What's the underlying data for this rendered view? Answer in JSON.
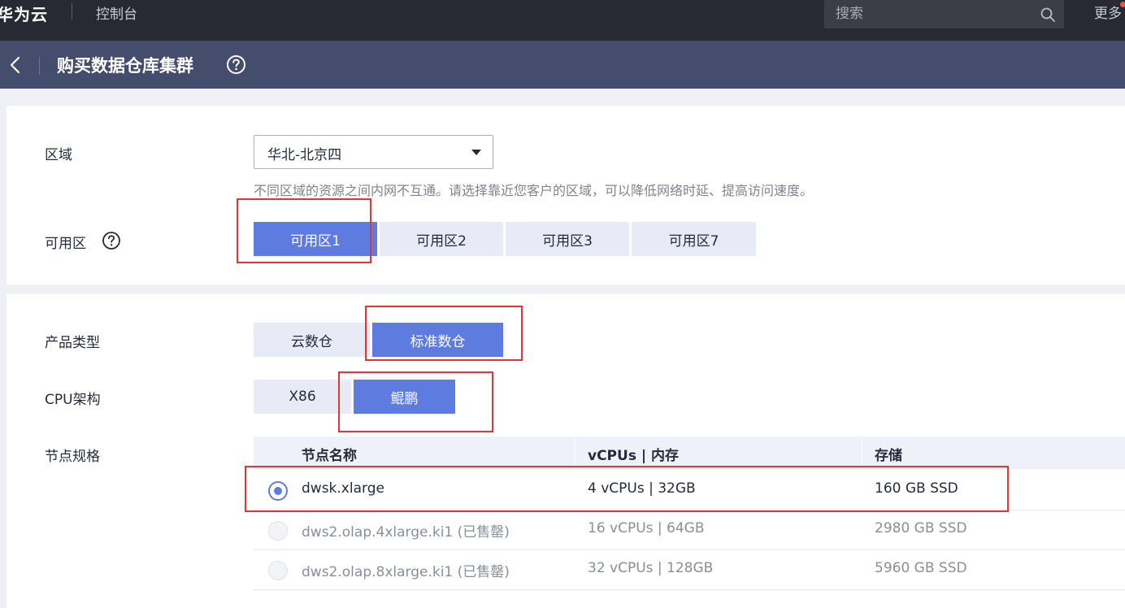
{
  "topbar": {
    "brand": "华为云",
    "console": "控制台",
    "search_placeholder": "搜索",
    "more": "更多"
  },
  "titlebar": {
    "title": "购买数据仓库集群"
  },
  "region": {
    "label": "区域",
    "selected": "华北-北京四",
    "hint": "不同区域的资源之间内网不互通。请选择靠近您客户的区域，可以降低网络时延、提高访问速度。"
  },
  "az": {
    "label": "可用区",
    "options": [
      "可用区1",
      "可用区2",
      "可用区3",
      "可用区7"
    ],
    "selected_index": 0
  },
  "product_type": {
    "label": "产品类型",
    "options": [
      "云数仓",
      "标准数仓"
    ],
    "selected_index": 1
  },
  "cpu_arch": {
    "label": "CPU架构",
    "options": [
      "X86",
      "鲲鹏"
    ],
    "selected_index": 1
  },
  "node_spec": {
    "label": "节点规格",
    "columns": [
      "节点名称",
      "vCPUs | 内存",
      "存储"
    ],
    "rows": [
      {
        "name": "dwsk.xlarge",
        "cpu_mem": "4 vCPUs | 32GB",
        "storage": "160 GB SSD",
        "selected": true,
        "disabled": false
      },
      {
        "name": "dws2.olap.4xlarge.ki1 (已售罄)",
        "cpu_mem": "16 vCPUs | 64GB",
        "storage": "2980 GB SSD",
        "selected": false,
        "disabled": true
      },
      {
        "name": "dws2.olap.8xlarge.ki1 (已售罄)",
        "cpu_mem": "32 vCPUs | 128GB",
        "storage": "5960 GB SSD",
        "selected": false,
        "disabled": true
      }
    ]
  },
  "colors": {
    "accent": "#5e7ce0",
    "annotation": "#e0353b",
    "topbar": "#272a33",
    "titlebar": "#454d6c"
  }
}
